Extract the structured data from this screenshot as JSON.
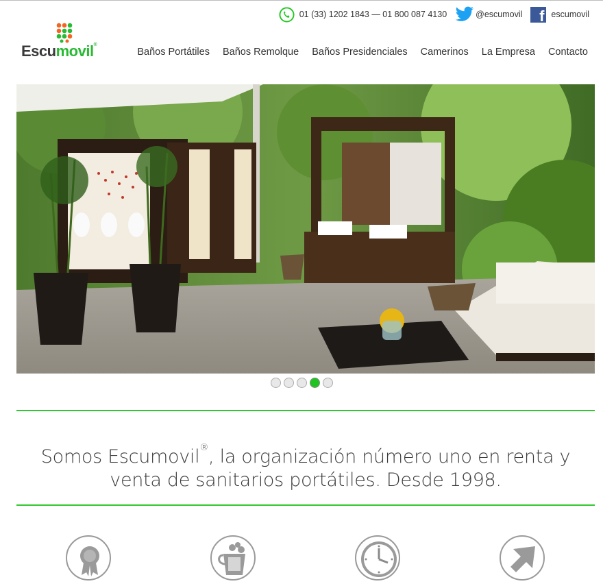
{
  "contact": {
    "phone": "01 (33) 1202 1843 — 01 800 087 4130",
    "twitter": "@escumovil",
    "facebook": "escumovil"
  },
  "logo": {
    "part1": "Escu",
    "part2": "movil",
    "reg": "®"
  },
  "nav": {
    "items": [
      "Baños Portátiles",
      "Baños Remolque",
      "Baños Presidenciales",
      "Camerinos",
      "La Empresa",
      "Contacto"
    ]
  },
  "slider": {
    "total": 5,
    "active_index": 4
  },
  "tagline": {
    "before": "Somos Escumovil",
    "reg": "®",
    "after": ", la organización número uno en renta y venta de sanitarios portátiles. Desde 1998."
  },
  "features": {
    "icons": [
      "award-badge-icon",
      "cleaning-bucket-icon",
      "clock-icon",
      "arrow-icon"
    ]
  },
  "colors": {
    "accent_green": "#29b933",
    "rule_green": "#30c830",
    "facebook_blue": "#3b5998",
    "twitter_blue": "#1da1f2"
  }
}
